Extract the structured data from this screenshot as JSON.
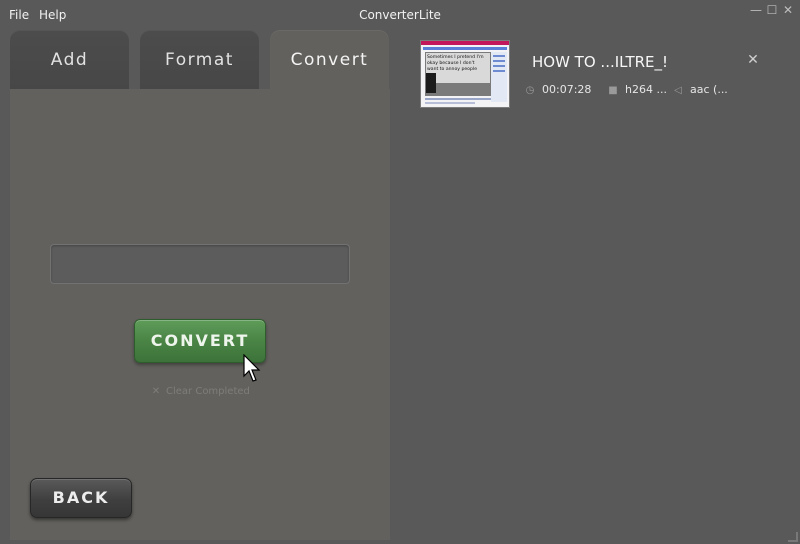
{
  "menu": {
    "file": "File",
    "help": "Help"
  },
  "app": {
    "title": "ConverterLite"
  },
  "window_controls": {
    "minimize": "—",
    "maximize": "☐",
    "close": "✕"
  },
  "tabs": {
    "add": "Add",
    "format": "Format",
    "convert": "Convert",
    "active": "Convert"
  },
  "convert_panel": {
    "progress_value": "",
    "convert_label": "CONVERT",
    "clear_completed": "Clear Completed",
    "back_label": "BACK"
  },
  "queue": {
    "items": [
      {
        "title": "HOW TO ...ILTRE_!",
        "duration": "00:07:28",
        "video": "h264 ...",
        "audio": "aac (...",
        "thumbnail_caption": "Sometimes I pretend I'm okay because I don't want to annoy people"
      }
    ]
  },
  "colors": {
    "window_bg": "#595959",
    "panel_bg": "#62615d",
    "accent_green": "#4a8445",
    "text": "#f2f2f2"
  }
}
